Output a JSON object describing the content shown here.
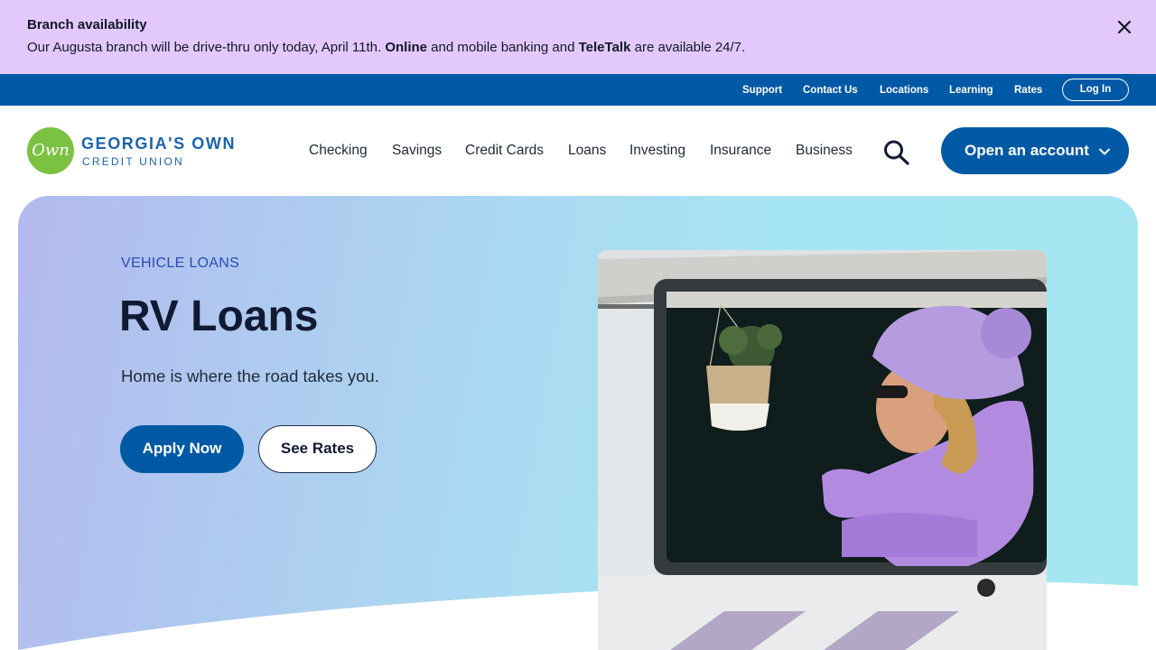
{
  "alert": {
    "title": "Branch availability",
    "message_parts": [
      "Our Augusta branch will be drive-thru only today, April 11th. ",
      "Online",
      " and mobile banking and ",
      "TeleTalk",
      " are available 24/7."
    ],
    "close_icon": "close-icon"
  },
  "utility_nav": {
    "links": [
      "Support",
      "Contact Us",
      "Locations",
      "Learning",
      "Rates"
    ],
    "login_label": "Log In"
  },
  "logo": {
    "mark_text": "Own",
    "name_line1": "GEORGIA'S OWN",
    "name_line2": "CREDIT UNION"
  },
  "main_nav": {
    "items": [
      "Checking",
      "Savings",
      "Credit Cards",
      "Loans",
      "Investing",
      "Insurance",
      "Business"
    ],
    "search_icon": "search-icon",
    "cta_label": "Open an account",
    "cta_icon": "chevron-down-icon"
  },
  "hero": {
    "eyebrow": "VEHICLE LOANS",
    "title": "RV Loans",
    "subtitle": "Home is where the road takes you.",
    "primary_button": "Apply Now",
    "secondary_button": "See Rates",
    "image": "woman-in-rv-window-photo"
  },
  "colors": {
    "alert_bg": "#e3c9fb",
    "brand_blue": "#0059a5",
    "logo_green": "#7cc242",
    "eyebrow_blue": "#2a4db5"
  }
}
